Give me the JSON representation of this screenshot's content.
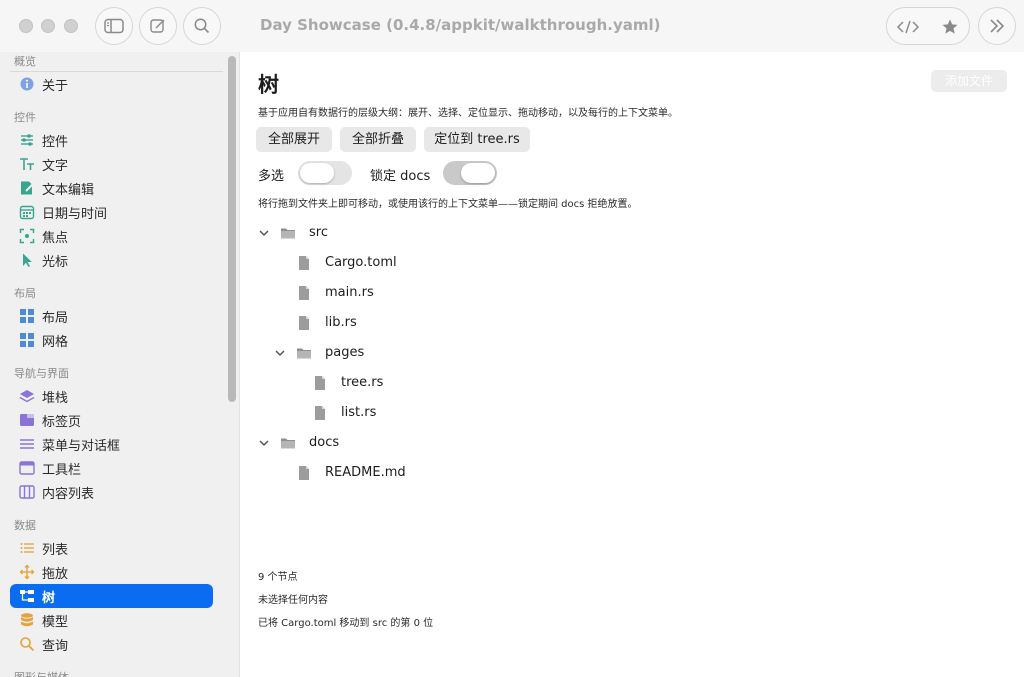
{
  "window": {
    "title": "Day Showcase (0.4.8/appkit/walkthrough.yaml)",
    "toolbar_icons": [
      "sidebar-toggle-icon",
      "compose-icon",
      "search-icon",
      "code-icon",
      "star-icon",
      "chevrons-right-icon"
    ]
  },
  "sidebar": {
    "sections": [
      {
        "title": "概览",
        "items": [
          {
            "label": "关于",
            "icon": "info-icon",
            "color": "#5a8de8"
          }
        ]
      },
      {
        "title": "控件",
        "items": [
          {
            "label": "控件",
            "icon": "sliders-icon",
            "color": "#3aa58f"
          },
          {
            "label": "文字",
            "icon": "text-icon",
            "color": "#3aa58f"
          },
          {
            "label": "文本编辑",
            "icon": "edit-icon",
            "color": "#3aa58f"
          },
          {
            "label": "日期与时间",
            "icon": "calendar-icon",
            "color": "#3aa58f"
          },
          {
            "label": "焦点",
            "icon": "focus-icon",
            "color": "#3aa58f"
          },
          {
            "label": "光标",
            "icon": "cursor-icon",
            "color": "#3aa58f"
          }
        ]
      },
      {
        "title": "布局",
        "items": [
          {
            "label": "布局",
            "icon": "layout-icon",
            "color": "#4f8ad6"
          },
          {
            "label": "网格",
            "icon": "grid-icon",
            "color": "#4f8ad6"
          }
        ]
      },
      {
        "title": "导航与界面",
        "items": [
          {
            "label": "堆栈",
            "icon": "stack-icon",
            "color": "#8b74d6"
          },
          {
            "label": "标签页",
            "icon": "tabs-icon",
            "color": "#8b74d6"
          },
          {
            "label": "菜单与对话框",
            "icon": "menu-icon",
            "color": "#8b74d6"
          },
          {
            "label": "工具栏",
            "icon": "toolbar-icon",
            "color": "#8b74d6"
          },
          {
            "label": "内容列表",
            "icon": "columns-icon",
            "color": "#8b74d6"
          }
        ]
      },
      {
        "title": "数据",
        "items": [
          {
            "label": "列表",
            "icon": "list-icon",
            "color": "#e8a23c"
          },
          {
            "label": "拖放",
            "icon": "move-icon",
            "color": "#e8a23c"
          },
          {
            "label": "树",
            "icon": "tree-icon",
            "color": "#ffffff",
            "active": true
          },
          {
            "label": "模型",
            "icon": "database-icon",
            "color": "#e8a23c"
          },
          {
            "label": "查询",
            "icon": "search-icon",
            "color": "#e8a23c"
          }
        ]
      },
      {
        "title": "图形与媒体",
        "items": []
      }
    ]
  },
  "main": {
    "title": "树",
    "add_button": "添加文件",
    "description": "基于应用自有数据行的层级大纲：展开、选择、定位显示、拖动移动，以及每行的上下文菜单。",
    "actions": [
      "全部展开",
      "全部折叠",
      "定位到 tree.rs"
    ],
    "toggles": [
      {
        "label": "多选",
        "on": false
      },
      {
        "label": "锁定 docs",
        "on": true
      }
    ],
    "hint": "将行拖到文件夹上即可移动，或使用该行的上下文菜单——锁定期间 docs 拒绝放置。",
    "tree": [
      {
        "name": "src",
        "type": "folder",
        "depth": 0,
        "expanded": true
      },
      {
        "name": "Cargo.toml",
        "type": "file",
        "depth": 1
      },
      {
        "name": "main.rs",
        "type": "file",
        "depth": 1
      },
      {
        "name": "lib.rs",
        "type": "file",
        "depth": 1
      },
      {
        "name": "pages",
        "type": "folder",
        "depth": 1,
        "expanded": true
      },
      {
        "name": "tree.rs",
        "type": "file",
        "depth": 2
      },
      {
        "name": "list.rs",
        "type": "file",
        "depth": 2
      },
      {
        "name": "docs",
        "type": "folder",
        "depth": 0,
        "expanded": true
      },
      {
        "name": "README.md",
        "type": "file",
        "depth": 1
      }
    ],
    "status": {
      "count": "9 个节点",
      "selection": "未选择任何内容",
      "last_action": "已将 Cargo.toml 移动到 src 的第 0 位"
    }
  }
}
